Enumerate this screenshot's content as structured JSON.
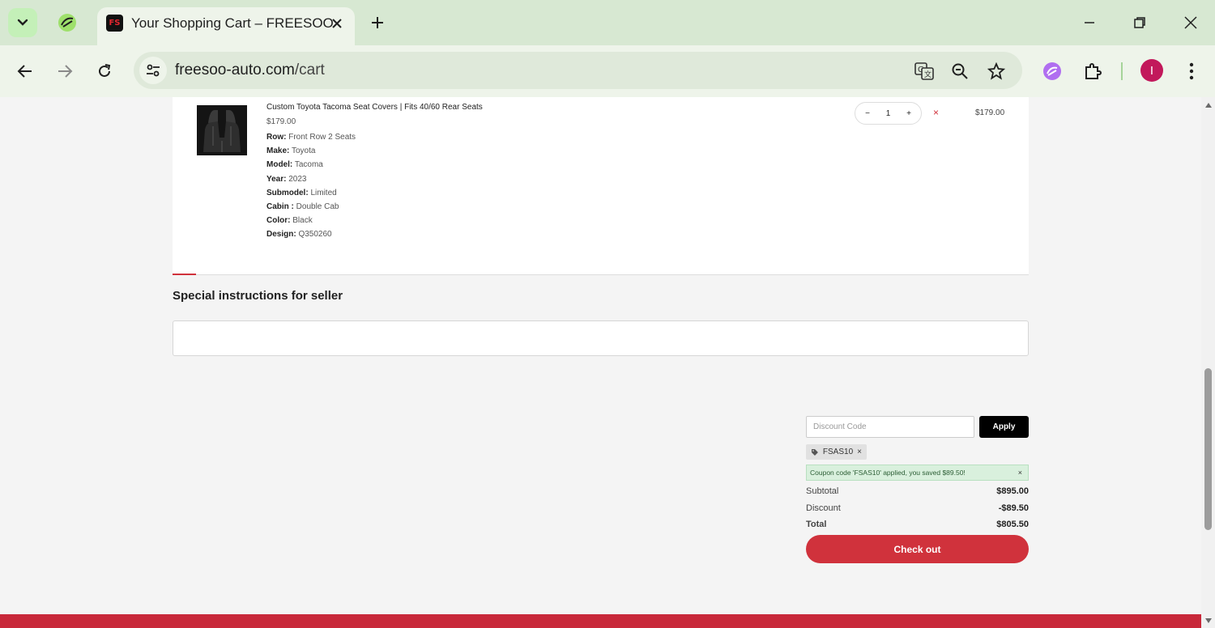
{
  "browser": {
    "tab_title": "Your Shopping Cart – FREESOO",
    "favicon_text": "FS",
    "url_domain": "freesoo-auto.com",
    "url_path": "/cart",
    "profile_initial": "I"
  },
  "cart_item": {
    "title": "Custom Toyota Tacoma Seat Covers | Fits 40/60 Rear Seats",
    "price": "$179.00",
    "properties": [
      {
        "label": "Row:",
        "value": "Front Row 2 Seats"
      },
      {
        "label": "Make:",
        "value": "Toyota"
      },
      {
        "label": "Model:",
        "value": "Tacoma"
      },
      {
        "label": "Year:",
        "value": "2023"
      },
      {
        "label": "Submodel:",
        "value": "Limited"
      },
      {
        "label": "Cabin :",
        "value": "Double Cab"
      },
      {
        "label": "Color:",
        "value": "Black"
      },
      {
        "label": "Design:",
        "value": "Q350260"
      }
    ],
    "quantity": "1",
    "qty_minus": "−",
    "qty_plus": "+",
    "remove_symbol": "×",
    "line_total": "$179.00"
  },
  "instructions": {
    "label": "Special instructions for seller",
    "value": ""
  },
  "discount": {
    "placeholder": "Discount Code",
    "apply_label": "Apply",
    "applied_code": "FSAS10",
    "chip_remove": "×",
    "message": "Coupon code 'FSAS10' applied, you saved $89.50!",
    "message_close": "×"
  },
  "summary": {
    "subtotal_label": "Subtotal",
    "subtotal_value": "$895.00",
    "discount_label": "Discount",
    "discount_value": "-$89.50",
    "total_label": "Total",
    "total_value": "$805.50",
    "checkout_label": "Check out"
  },
  "colors": {
    "accent_red": "#d0323c",
    "footer_red": "#c8283a",
    "chrome_green": "#d7e8d2"
  }
}
